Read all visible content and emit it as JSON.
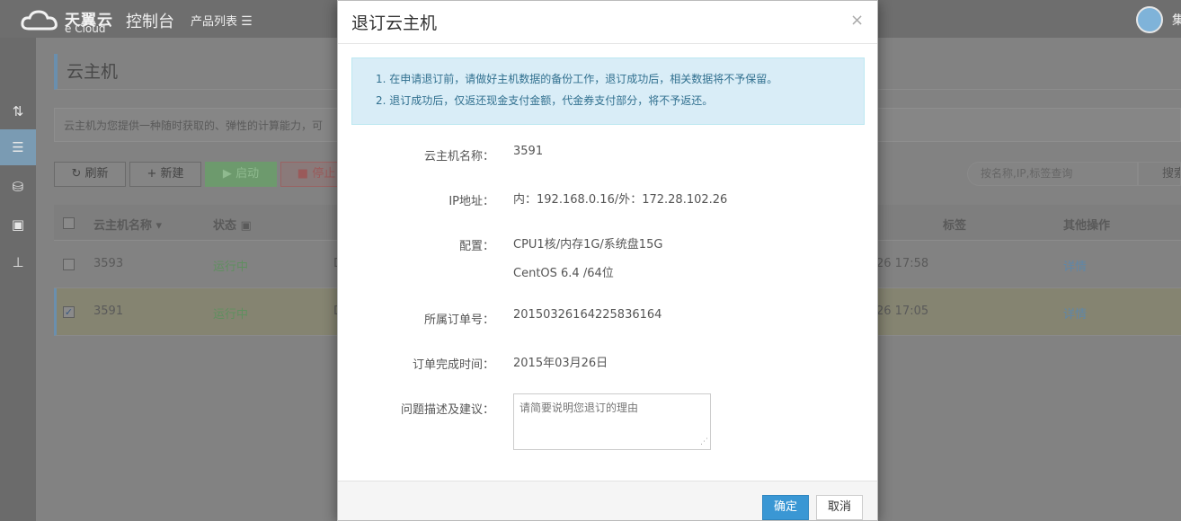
{
  "header": {
    "logo_cn": "天翼云",
    "logo_en": "e Cloud",
    "console_title": "控制台",
    "product_list_label": "产品列表",
    "user_name_partial": "集"
  },
  "sidebar": {
    "icons": [
      "sort-icon",
      "list-icon",
      "database-icon",
      "archive-icon",
      "sitemap-icon"
    ],
    "active_index": 1,
    "expand_glyph": "»"
  },
  "main": {
    "page_title": "云主机",
    "description": "云主机为您提供一种随时获取的、弹性的计算能力，可",
    "toolbar": {
      "refresh_label": "刷新",
      "new_label": "新建",
      "start_label": "启动",
      "stop_label": "停止"
    },
    "search": {
      "placeholder": "按名称,IP,标签查询",
      "button_label": "搜索"
    },
    "table": {
      "headers": {
        "name": "云主机名称 ▾",
        "status": "状态 ▣",
        "tags": "标签",
        "actions": "其他操作"
      },
      "rows": [
        {
          "name": "3593",
          "status": "运行中",
          "col3": "D",
          "time": "26 17:58",
          "action": "详情",
          "checked": false
        },
        {
          "name": "3591",
          "status": "运行中",
          "col3": "D",
          "time": "26 17:05",
          "action": "详情",
          "checked": true
        }
      ]
    }
  },
  "modal": {
    "title": "退订云主机",
    "close_glyph": "×",
    "notice": [
      "1. 在申请退订前，请做好主机数据的备份工作，退订成功后，相关数据将不予保留。",
      "2. 退订成功后，仅返还现金支付金额，代金券支付部分，将不予返还。"
    ],
    "fields": {
      "name_label": "云主机名称：",
      "name_value": "3591",
      "ip_label": "IP地址：",
      "ip_value": "内：192.168.0.16/外：172.28.102.26",
      "config_label": "配置：",
      "config_value_1": "CPU1核/内存1G/系统盘15G",
      "config_value_2": "CentOS 6.4 /64位",
      "order_label": "所属订单号：",
      "order_value": "20150326164225836164",
      "time_label": "订单完成时间：",
      "time_value": "2015年03月26日",
      "reason_label": "问题描述及建议：",
      "reason_placeholder": "请简要说明您退订的理由"
    },
    "confirm_label": "确定",
    "cancel_label": "取消"
  }
}
